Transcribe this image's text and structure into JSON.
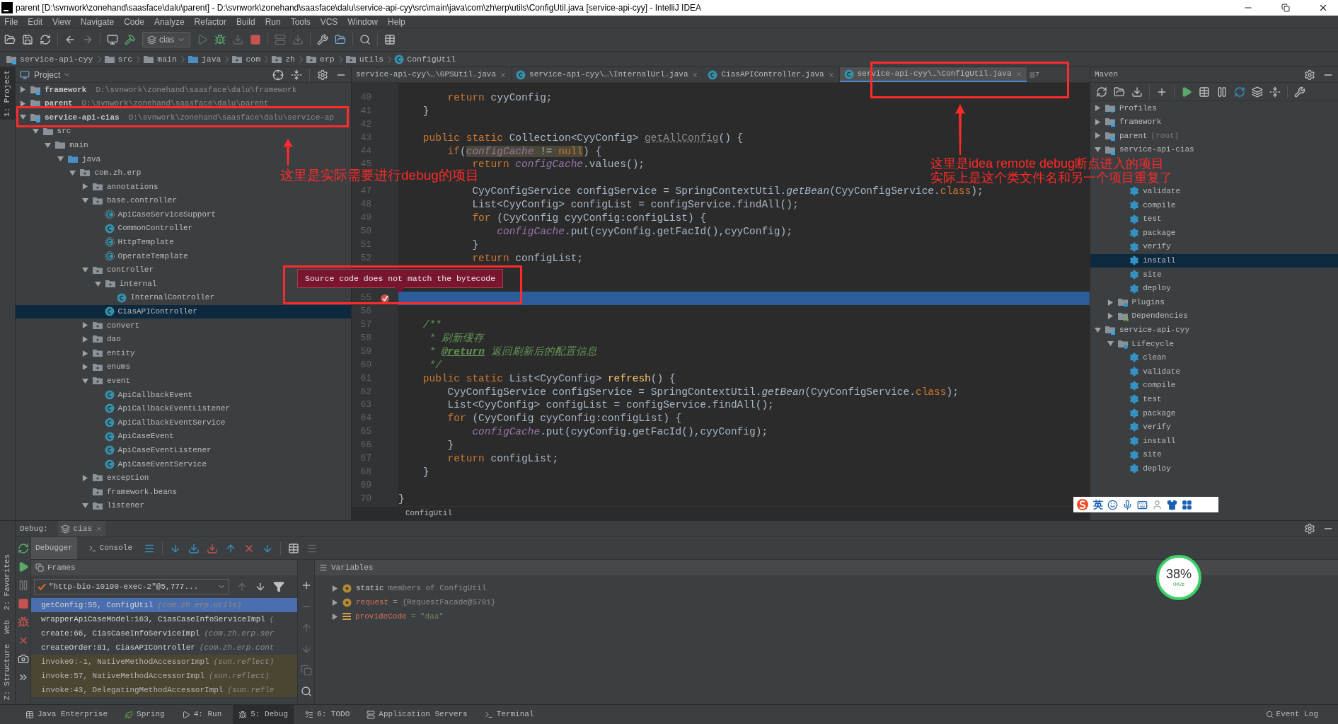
{
  "window": {
    "title": "parent [D:\\svnwork\\zonehand\\saasface\\dalu\\parent] - D:\\svnwork\\zonehand\\saasface\\dalu\\service-api-cyy\\src\\main\\java\\com\\zh\\erp\\utils\\ConfigUtil.java [service-api-cyy] - IntelliJ IDEA"
  },
  "menu": [
    "File",
    "Edit",
    "View",
    "Navigate",
    "Code",
    "Analyze",
    "Refactor",
    "Build",
    "Run",
    "Tools",
    "VCS",
    "Window",
    "Help"
  ],
  "toolbar": {
    "run_config": "cias"
  },
  "breadcrumb": [
    {
      "label": "service-api-cyy",
      "kind": "module"
    },
    {
      "label": "src",
      "kind": "folder"
    },
    {
      "label": "main",
      "kind": "folder"
    },
    {
      "label": "java",
      "kind": "source"
    },
    {
      "label": "com",
      "kind": "package"
    },
    {
      "label": "zh",
      "kind": "package"
    },
    {
      "label": "erp",
      "kind": "package"
    },
    {
      "label": "utils",
      "kind": "package"
    },
    {
      "label": "ConfigUtil",
      "kind": "class"
    }
  ],
  "left_tabs_top": [
    "1: Project"
  ],
  "left_tabs_bottom": [
    "2: Favorites",
    "Web",
    "Z: Structure"
  ],
  "project": {
    "title": "Project",
    "tree": [
      {
        "label": "framework",
        "path": "D:\\svnwork\\zonehand\\saasface\\dalu\\framework",
        "kind": "module",
        "expanded": false,
        "selected": false
      },
      {
        "label": "parent",
        "path": "D:\\svnwork\\zonehand\\saasface\\dalu\\parent",
        "kind": "module",
        "expanded": false,
        "selected": false
      },
      {
        "label": "service-api-cias",
        "path": "D:\\svnwork\\zonehand\\saasface\\dalu\\service-ap",
        "kind": "module",
        "expanded": true,
        "selected": false,
        "children": [
          {
            "label": "src",
            "kind": "folder",
            "expanded": true,
            "selected": false,
            "children": [
              {
                "label": "main",
                "kind": "folder",
                "expanded": true,
                "selected": false,
                "children": [
                  {
                    "label": "java",
                    "kind": "source",
                    "expanded": true,
                    "selected": false,
                    "children": [
                      {
                        "label": "com.zh.erp",
                        "kind": "package",
                        "expanded": true,
                        "selected": false,
                        "children": [
                          {
                            "label": "annotations",
                            "kind": "package",
                            "expanded": false,
                            "selected": false
                          },
                          {
                            "label": "base.controller",
                            "kind": "package",
                            "expanded": true,
                            "selected": false,
                            "children": [
                              {
                                "label": "ApiCaseServiceSupport",
                                "kind": "abstract",
                                "selected": false
                              },
                              {
                                "label": "CommonController",
                                "kind": "class",
                                "selected": false
                              },
                              {
                                "label": "HttpTemplate",
                                "kind": "abstract",
                                "selected": false
                              },
                              {
                                "label": "OperateTemplate",
                                "kind": "abstract",
                                "selected": false
                              }
                            ]
                          },
                          {
                            "label": "controller",
                            "kind": "package",
                            "expanded": true,
                            "selected": false,
                            "children": [
                              {
                                "label": "internal",
                                "kind": "package",
                                "expanded": true,
                                "selected": false,
                                "children": [
                                  {
                                    "label": "InternalController",
                                    "kind": "class",
                                    "selected": false
                                  }
                                ]
                              },
                              {
                                "label": "CiasAPIController",
                                "kind": "class",
                                "selected": true
                              }
                            ]
                          },
                          {
                            "label": "convert",
                            "kind": "package",
                            "expanded": false,
                            "selected": false
                          },
                          {
                            "label": "dao",
                            "kind": "package",
                            "expanded": false,
                            "selected": false
                          },
                          {
                            "label": "entity",
                            "kind": "package",
                            "expanded": false,
                            "selected": false
                          },
                          {
                            "label": "enums",
                            "kind": "package",
                            "expanded": false,
                            "selected": false
                          },
                          {
                            "label": "event",
                            "kind": "package",
                            "expanded": true,
                            "selected": false,
                            "children": [
                              {
                                "label": "ApiCallbackEvent",
                                "kind": "class",
                                "selected": false
                              },
                              {
                                "label": "ApiCallbackEventListener",
                                "kind": "class",
                                "selected": false
                              },
                              {
                                "label": "ApiCallbackEventService",
                                "kind": "class",
                                "selected": false
                              },
                              {
                                "label": "ApiCaseEvent",
                                "kind": "class",
                                "selected": false
                              },
                              {
                                "label": "ApiCaseEventListener",
                                "kind": "class",
                                "selected": false
                              },
                              {
                                "label": "ApiCaseEventService",
                                "kind": "class",
                                "selected": false
                              }
                            ]
                          },
                          {
                            "label": "exception",
                            "kind": "package",
                            "expanded": false,
                            "selected": false
                          },
                          {
                            "label": "framework.beans",
                            "kind": "package",
                            "selected": false
                          },
                          {
                            "label": "listener",
                            "kind": "package",
                            "expanded": true,
                            "selected": false
                          }
                        ]
                      }
                    ]
                  }
                ]
              }
            ]
          }
        ]
      }
    ]
  },
  "editor": {
    "tabs": [
      {
        "label": "service-api-cyy\\…\\GPSUtil.java",
        "icon": false,
        "selected": false
      },
      {
        "label": "service-api-cyy\\…\\InternalUrl.java",
        "icon": true,
        "selected": false
      },
      {
        "label": "CiasAPIController.java",
        "icon": true,
        "selected": false
      },
      {
        "label": "service-api-cyy\\…\\ConfigUtil.java",
        "icon": true,
        "selected": true
      }
    ],
    "tab_count": "7",
    "lines": [
      {
        "number": "40",
        "kind": "code",
        "current": false,
        "breakpoint": false,
        "tokens": [
          {
            "kind": "kw",
            "text": "        return"
          },
          {
            "kind": "plain",
            "text": " cyyConfig;"
          }
        ]
      },
      {
        "number": "41",
        "kind": "code",
        "current": false,
        "breakpoint": false,
        "tokens": [
          {
            "kind": "plain",
            "text": "    }"
          }
        ]
      },
      {
        "number": "42",
        "kind": "code",
        "current": false,
        "breakpoint": false
      },
      {
        "number": "43",
        "kind": "code",
        "current": false,
        "breakpoint": false,
        "tokens": [
          {
            "kind": "kw",
            "text": "    public static"
          },
          {
            "kind": "plain",
            "text": " Collection<CyyConfig> "
          },
          {
            "kind": "unused",
            "text": "getAllConfig"
          },
          {
            "kind": "plain",
            "text": "() {"
          }
        ]
      },
      {
        "number": "44",
        "kind": "code",
        "current": false,
        "breakpoint": false,
        "tokens": [
          {
            "kind": "kw",
            "text": "        if"
          },
          {
            "kind": "plain",
            "text": "("
          },
          {
            "kind": "field-marked",
            "text": "configCache"
          },
          {
            "kind": "plain-marked",
            "text": " != "
          },
          {
            "kind": "kw-marked",
            "text": "null"
          },
          {
            "kind": "plain",
            "text": ") {"
          }
        ]
      },
      {
        "number": "45",
        "kind": "code",
        "current": false,
        "breakpoint": false,
        "tokens": [
          {
            "kind": "kw",
            "text": "            return "
          },
          {
            "kind": "field",
            "text": "configCache"
          },
          {
            "kind": "plain",
            "text": ".values();"
          }
        ]
      },
      {
        "kind": "covered"
      },
      {
        "number": "47",
        "kind": "code",
        "current": false,
        "breakpoint": false,
        "tokens": [
          {
            "kind": "plain",
            "text": "            CyyConfigService configService = SpringContextUtil."
          },
          {
            "kind": "static",
            "text": "getBean"
          },
          {
            "kind": "plain",
            "text": "(CyyConfigService."
          },
          {
            "kind": "kw",
            "text": "class"
          },
          {
            "kind": "plain",
            "text": ");"
          }
        ]
      },
      {
        "number": "48",
        "kind": "code",
        "current": false,
        "breakpoint": false,
        "tokens": [
          {
            "kind": "plain",
            "text": "            List<CyyConfig> configList = configService.findAll();"
          }
        ]
      },
      {
        "number": "49",
        "kind": "code",
        "current": false,
        "breakpoint": false,
        "tokens": [
          {
            "kind": "kw",
            "text": "            for"
          },
          {
            "kind": "plain",
            "text": " (CyyConfig cyyConfig:configList) {"
          }
        ]
      },
      {
        "number": "50",
        "kind": "code",
        "current": false,
        "breakpoint": false,
        "tokens": [
          {
            "kind": "field",
            "text": "                configCache"
          },
          {
            "kind": "plain",
            "text": ".put(cyyConfig.getFacId(),cyyConfig);"
          }
        ]
      },
      {
        "number": "51",
        "kind": "code",
        "current": false,
        "breakpoint": false,
        "tokens": [
          {
            "kind": "plain",
            "text": "            }"
          }
        ]
      },
      {
        "number": "52",
        "kind": "code",
        "current": false,
        "breakpoint": false,
        "tokens": [
          {
            "kind": "kw",
            "text": "            return"
          },
          {
            "kind": "plain",
            "text": " configList;"
          }
        ]
      },
      {
        "kind": "covered"
      },
      {
        "kind": "covered"
      },
      {
        "number": "55",
        "kind": "code",
        "current": true,
        "breakpoint": true
      },
      {
        "number": "56",
        "kind": "code",
        "current": false,
        "breakpoint": false
      },
      {
        "number": "57",
        "kind": "code",
        "current": false,
        "breakpoint": false,
        "tokens": [
          {
            "kind": "doc",
            "text": "    /**"
          }
        ]
      },
      {
        "number": "58",
        "kind": "code",
        "current": false,
        "breakpoint": false,
        "tokens": [
          {
            "kind": "doc",
            "text": "     * 刷新缓存"
          }
        ]
      },
      {
        "number": "59",
        "kind": "code",
        "current": false,
        "breakpoint": false,
        "tokens": [
          {
            "kind": "doc",
            "text": "     * "
          },
          {
            "kind": "doc-tag",
            "text": "@return"
          },
          {
            "kind": "doc",
            "text": " 返回刷新后的配置信息"
          }
        ]
      },
      {
        "number": "60",
        "kind": "code",
        "current": false,
        "breakpoint": false,
        "tokens": [
          {
            "kind": "doc",
            "text": "     */"
          }
        ]
      },
      {
        "number": "61",
        "kind": "code",
        "current": false,
        "breakpoint": false,
        "tokens": [
          {
            "kind": "kw",
            "text": "    public static"
          },
          {
            "kind": "plain",
            "text": " List<CyyConfig> "
          },
          {
            "kind": "method",
            "text": "refresh"
          },
          {
            "kind": "plain",
            "text": "() {"
          }
        ]
      },
      {
        "number": "62",
        "kind": "code",
        "current": false,
        "breakpoint": false,
        "tokens": [
          {
            "kind": "plain",
            "text": "        CyyConfigService configService = SpringContextUtil."
          },
          {
            "kind": "static",
            "text": "getBean"
          },
          {
            "kind": "plain",
            "text": "(CyyConfigService."
          },
          {
            "kind": "kw",
            "text": "class"
          },
          {
            "kind": "plain",
            "text": ");"
          }
        ]
      },
      {
        "number": "63",
        "kind": "code",
        "current": false,
        "breakpoint": false,
        "tokens": [
          {
            "kind": "plain",
            "text": "        List<CyyConfig> configList = configService.findAll();"
          }
        ]
      },
      {
        "number": "64",
        "kind": "code",
        "current": false,
        "breakpoint": false,
        "tokens": [
          {
            "kind": "kw",
            "text": "        for"
          },
          {
            "kind": "plain",
            "text": " (CyyConfig cyyConfig:configList) {"
          }
        ]
      },
      {
        "number": "65",
        "kind": "code",
        "current": false,
        "breakpoint": false,
        "tokens": [
          {
            "kind": "field",
            "text": "            configCache"
          },
          {
            "kind": "plain",
            "text": ".put(cyyConfig.getFacId(),cyyConfig);"
          }
        ]
      },
      {
        "number": "66",
        "kind": "code",
        "current": false,
        "breakpoint": false,
        "tokens": [
          {
            "kind": "plain",
            "text": "        }"
          }
        ]
      },
      {
        "number": "67",
        "kind": "code",
        "current": false,
        "breakpoint": false,
        "tokens": [
          {
            "kind": "kw",
            "text": "        return"
          },
          {
            "kind": "plain",
            "text": " configList;"
          }
        ]
      },
      {
        "number": "68",
        "kind": "code",
        "current": false,
        "breakpoint": false,
        "tokens": [
          {
            "kind": "plain",
            "text": "    }"
          }
        ]
      },
      {
        "number": "69",
        "kind": "code",
        "current": false,
        "breakpoint": false
      },
      {
        "number": "70",
        "kind": "code",
        "current": false,
        "breakpoint": false,
        "tokens": [
          {
            "kind": "plain",
            "text": "}"
          }
        ]
      }
    ],
    "breadcrumb": "ConfigUtil",
    "tooltip": "Source code does not match the bytecode"
  },
  "maven": {
    "title": "Maven",
    "tree": [
      {
        "label": "Profiles",
        "kind": "profiles",
        "expanded": false,
        "selected": false
      },
      {
        "label": "framework",
        "kind": "module",
        "expanded": false,
        "selected": false
      },
      {
        "label": "parent",
        "note": "(root)",
        "kind": "module",
        "expanded": false,
        "selected": false
      },
      {
        "label": "service-api-cias",
        "kind": "module",
        "expanded": true,
        "selected": false,
        "children": [
          {
            "kind": "covered",
            "children": [
              {
                "kind": "covered"
              },
              {
                "label": "validate",
                "kind": "goal",
                "selected": false
              },
              {
                "label": "compile",
                "kind": "goal",
                "selected": false
              },
              {
                "label": "test",
                "kind": "goal",
                "selected": false
              },
              {
                "label": "package",
                "kind": "goal",
                "selected": false
              },
              {
                "label": "verify",
                "kind": "goal",
                "selected": false
              },
              {
                "label": "install",
                "kind": "goal",
                "selected": true
              },
              {
                "label": "site",
                "kind": "goal",
                "selected": false
              },
              {
                "label": "deploy",
                "kind": "goal",
                "selected": false
              }
            ]
          },
          {
            "label": "Plugins",
            "kind": "plugins",
            "expanded": false,
            "selected": false
          },
          {
            "label": "Dependencies",
            "kind": "dependencies",
            "expanded": false,
            "selected": false
          }
        ]
      },
      {
        "label": "service-api-cyy",
        "kind": "module",
        "expanded": true,
        "selected": false,
        "children": [
          {
            "label": "Lifecycle",
            "kind": "lifecycle",
            "expanded": true,
            "selected": false,
            "children": [
              {
                "label": "clean",
                "kind": "goal",
                "selected": false
              },
              {
                "label": "validate",
                "kind": "goal",
                "selected": false
              },
              {
                "label": "compile",
                "kind": "goal",
                "selected": false
              },
              {
                "label": "test",
                "kind": "goal",
                "selected": false
              },
              {
                "label": "package",
                "kind": "goal",
                "selected": false
              },
              {
                "label": "verify",
                "kind": "goal",
                "selected": false
              },
              {
                "label": "install",
                "kind": "goal",
                "selected": false
              },
              {
                "label": "site",
                "kind": "goal",
                "selected": false
              },
              {
                "label": "deploy",
                "kind": "goal",
                "selected": false
              }
            ]
          }
        ]
      }
    ]
  },
  "debug": {
    "label": "Debug:",
    "session": "cias",
    "tabs": [
      {
        "label": "Debugger",
        "selected": true
      },
      {
        "label": "Console",
        "selected": false
      }
    ],
    "frames_title": "Frames",
    "variables_title": "Variables",
    "thread": "\"http-bio-10190-exec-2\"@5,777...",
    "frames": [
      {
        "method": "getConfig:55, ConfigUtil",
        "package": "(com.zh.erp.utils)",
        "library": false,
        "selected": true
      },
      {
        "method": "wrapperApiCaseModel:163, CiasCaseInfoServiceImpl",
        "package": "(",
        "library": false,
        "selected": false
      },
      {
        "method": "create:66, CiasCaseInfoServiceImpl",
        "package": "(com.zh.erp.ser",
        "library": false,
        "selected": false
      },
      {
        "method": "createOrder:81, CiasAPIController",
        "package": "(com.zh.erp.cont",
        "library": false,
        "selected": false
      },
      {
        "method": "invoke0:-1, NativeMethodAccessorImpl",
        "package": "(sun.reflect)",
        "library": true,
        "selected": false
      },
      {
        "method": "invoke:57, NativeMethodAccessorImpl",
        "package": "(sun.reflect)",
        "library": true,
        "selected": false
      },
      {
        "method": "invoke:43, DelegatingMethodAccessorImpl",
        "package": "(sun.refle",
        "library": true,
        "selected": false
      }
    ],
    "variables": [
      {
        "kind": "static",
        "name": "static",
        "value": "members of ConfigUtil"
      },
      {
        "kind": "param",
        "name": "request",
        "value": "= {RequestFacade@5781}"
      },
      {
        "kind": "field",
        "name": "provideCode",
        "value": "= \"daa\""
      }
    ]
  },
  "bottom_tools": [
    {
      "label": "Java Enterprise",
      "selected": false
    },
    {
      "label": "Spring",
      "selected": false
    },
    {
      "label": "4: Run",
      "selected": false
    },
    {
      "label": "5: Debug",
      "selected": true
    },
    {
      "label": "6: TODO",
      "selected": false
    },
    {
      "label": "Application Servers",
      "selected": false
    },
    {
      "label": "Terminal",
      "selected": false
    }
  ],
  "event_log": "Event Log",
  "annotations": {
    "project_note": "这里是实际需要进行debug的项目",
    "tab_note": [
      "这里是idea remote debug断点进入的项目",
      "实际上是这个类文件名和另一个项目重复了"
    ]
  },
  "ime": {
    "label": "英"
  },
  "speed_widget": {
    "percent": "38%",
    "rate": "0K/s"
  }
}
